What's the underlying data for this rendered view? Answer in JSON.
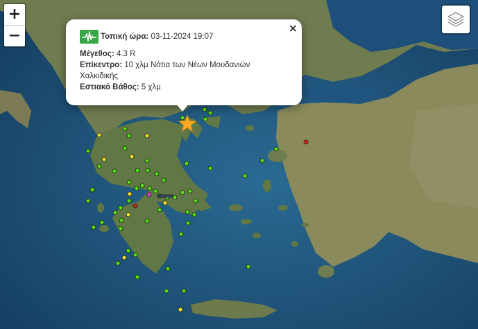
{
  "zoom": {
    "in_label": "+",
    "out_label": "−"
  },
  "icons": {
    "layers": "layers-icon",
    "seismograph": "seismograph-icon",
    "close": "close-icon",
    "epicenter": "star-icon"
  },
  "popup": {
    "time_label": "Τοπική ώρα:",
    "time_value": " 03-11-2024 19:07",
    "magnitude_label": "Μέγεθος:",
    "magnitude_value": " 4.3 R",
    "epicenter_label": "Επίκεντρο:",
    "epicenter_value": " 10 χλμ Νότια των Νέων Μουδανιών",
    "epicenter_value_cont": "Χαλκιδικής",
    "depth_label": "Εστιακό Βάθος:",
    "depth_value": " 5 χλμ",
    "close_label": "×"
  },
  "colors": {
    "sea": "#1b4f78",
    "land": "#6e7b52",
    "marker_green": "#55dd11",
    "marker_yellow": "#f2e22a",
    "marker_red": "#d8201c",
    "marker_magenta": "#e03ad0",
    "star": "#f7a823",
    "icon_green": "#3aa64a"
  }
}
